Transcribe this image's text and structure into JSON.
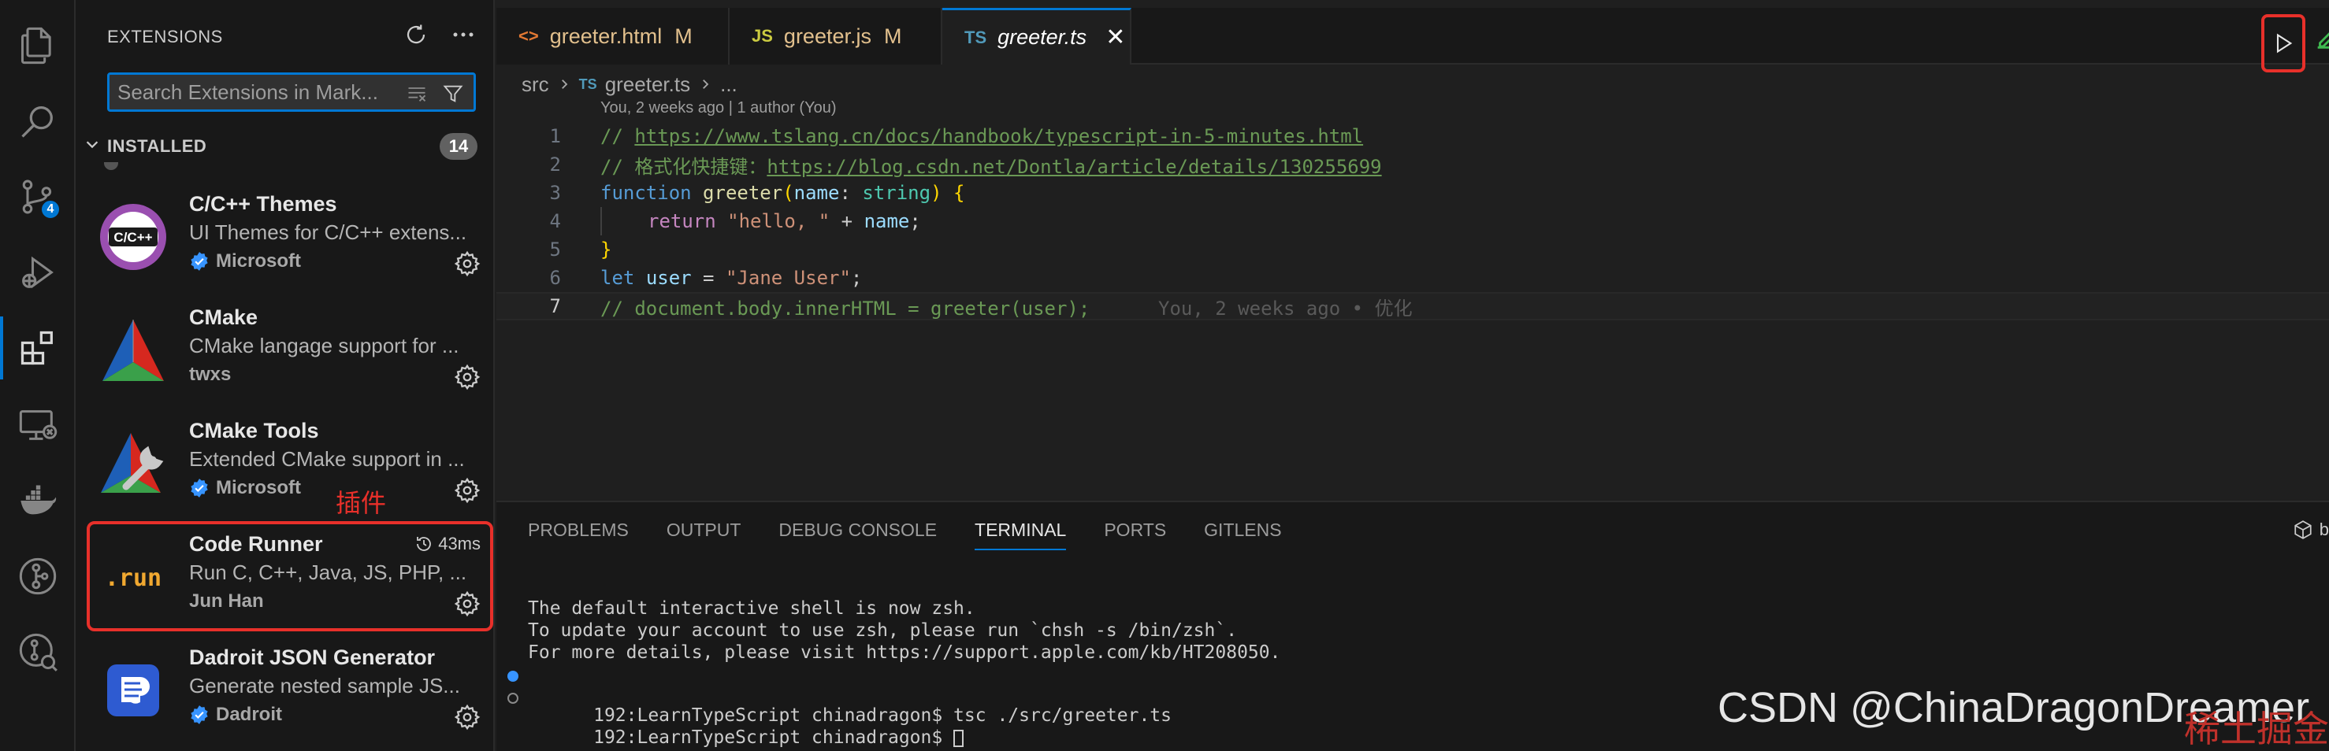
{
  "activity_bar": {
    "items": [
      {
        "name": "explorer-icon"
      },
      {
        "name": "search-icon"
      },
      {
        "name": "source-control-icon",
        "badge": "4"
      },
      {
        "name": "run-debug-icon"
      },
      {
        "name": "extensions-icon"
      },
      {
        "name": "remote-explorer-icon"
      },
      {
        "name": "docker-icon"
      },
      {
        "name": "gitlens-icon"
      },
      {
        "name": "gitlens-inspect-icon"
      }
    ]
  },
  "sidebar": {
    "title": "EXTENSIONS",
    "search_placeholder": "Search Extensions in Mark...",
    "installed_label": "INSTALLED",
    "installed_count": "14",
    "annotation": "插件",
    "extensions": [
      {
        "name": "C/C++ Themes",
        "desc": "UI Themes for C/C++ extens...",
        "publisher": "Microsoft",
        "verified": true,
        "icon_text": "C/C++"
      },
      {
        "name": "CMake",
        "desc": "CMake langage support for ...",
        "publisher": "twxs",
        "verified": false
      },
      {
        "name": "CMake Tools",
        "desc": "Extended CMake support in ...",
        "publisher": "Microsoft",
        "verified": true
      },
      {
        "name": "Code Runner",
        "desc": "Run C, C++, Java, JS, PHP, ...",
        "publisher": "Jun Han",
        "verified": false,
        "time": "43ms",
        "icon_text": ".run"
      },
      {
        "name": "Dadroit JSON Generator",
        "desc": "Generate nested sample JS...",
        "publisher": "Dadroit",
        "verified": true
      }
    ]
  },
  "tabs": [
    {
      "icon": "<>",
      "name": "greeter.html",
      "mod": "M",
      "icon_color": "#e37933"
    },
    {
      "icon": "JS",
      "name": "greeter.js",
      "mod": "M",
      "icon_color": "#cbcb41"
    },
    {
      "icon": "TS",
      "name": "greeter.ts",
      "mod": "",
      "icon_color": "#519aba",
      "close": "✕"
    }
  ],
  "breadcrumb": {
    "folder": "src",
    "file": "greeter.ts",
    "more": "...",
    "file_icon": "TS"
  },
  "blame_header": "You, 2 weeks ago | 1 author (You)",
  "code": {
    "line_numbers": [
      "1",
      "2",
      "3",
      "4",
      "5",
      "6",
      "7"
    ],
    "l1_prefix": "// ",
    "l1_url": "https://www.tslang.cn/docs/handbook/typescript-in-5-minutes.html",
    "l2_prefix": "// 格式化快捷键：",
    "l2_url": "https://blog.csdn.net/Dontla/article/details/130255699",
    "l3_kw": "function",
    "l3_fn": "greeter",
    "l3_p1": "(",
    "l3_param": "name",
    "l3_colon": ": ",
    "l3_type": "string",
    "l3_p2": ")",
    "l3_brace": " {",
    "l4_kw": "return",
    "l4_str": "\"hello, \"",
    "l4_plus": " + ",
    "l4_var": "name",
    "l4_semi": ";",
    "l5_brace": "}",
    "l6_kw": "let",
    "l6_var": "user",
    "l6_eq": " = ",
    "l6_str": "\"Jane User\"",
    "l6_semi": ";",
    "l7_comment": "// document.body.innerHTML = greeter(user);",
    "l7_blame": "You, 2 weeks ago • 优化"
  },
  "panel": {
    "tabs": [
      "PROBLEMS",
      "OUTPUT",
      "DEBUG CONSOLE",
      "TERMINAL",
      "PORTS",
      "GITLENS"
    ],
    "active_tab": "TERMINAL",
    "right_label": "b",
    "terminal_lines": [
      "The default interactive shell is now zsh.",
      "To update your account to use zsh, please run `chsh -s /bin/zsh`.",
      "For more details, please visit https://support.apple.com/kb/HT208050.",
      "192:LearnTypeScript chinadragon$ tsc ./src/greeter.ts",
      "192:LearnTypeScript chinadragon$ "
    ]
  },
  "watermark": "CSDN @ChinaDragonDreamer",
  "watermark2": "稀土掘金",
  "colors": {
    "accent": "#0078d4",
    "highlight": "#e8302a"
  }
}
